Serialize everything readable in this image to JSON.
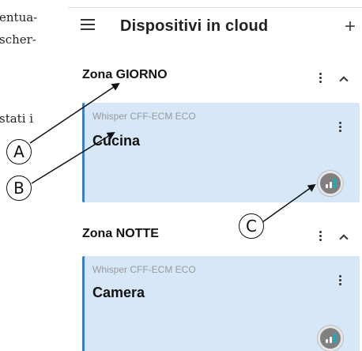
{
  "document": {
    "fragments": [
      "entua-",
      "scher-",
      "stati i"
    ]
  },
  "appbar": {
    "title": "Dispositivi in cloud",
    "menu_icon": "hamburger-menu-icon",
    "add_label": "+"
  },
  "zones": [
    {
      "title": "Zona GIORNO",
      "devices": [
        {
          "model": "Whisper CFF-ECM ECO",
          "name": "Cucina"
        }
      ]
    },
    {
      "title": "Zona NOTTE",
      "devices": [
        {
          "model": "Whisper CFF-ECM ECO",
          "name": "Camera"
        }
      ]
    }
  ],
  "callouts": [
    "A",
    "B",
    "C"
  ],
  "colors": {
    "card_background": "#d6e8f7",
    "card_accent": "#2a86d0",
    "status_button": "#808080"
  }
}
